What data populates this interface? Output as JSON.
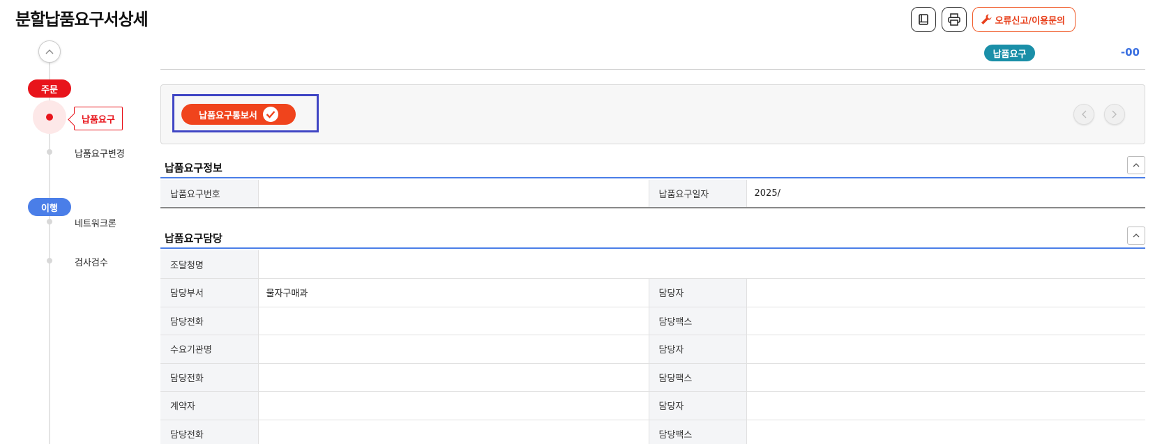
{
  "page": {
    "title": "분할납품요구서상세"
  },
  "top_actions": {
    "manual_label": "manual",
    "print_label": "print",
    "report_label": "오류신고/이용문의"
  },
  "timeline": {
    "order_stage": "주문",
    "exec_stage": "이행",
    "items": [
      {
        "label": "납품요구",
        "active": true
      },
      {
        "label": "납품요구변경"
      },
      {
        "label": "네트워크론"
      },
      {
        "label": "검사검수"
      }
    ]
  },
  "status": {
    "pill": "납품요구",
    "number": "-00"
  },
  "document": {
    "button_label": "납품요구통보서"
  },
  "section_info": {
    "title": "납품요구정보",
    "rows": [
      {
        "l1": "납품요구번호",
        "v1": "",
        "l2": "납품요구일자",
        "v2": "2025/"
      }
    ]
  },
  "section_contact": {
    "title": "납품요구담당",
    "rows": [
      {
        "l1": "조달청명",
        "v1": ""
      },
      {
        "l1": "담당부서",
        "v1": "물자구매과",
        "l2": "담당자",
        "v2": ""
      },
      {
        "l1": "담당전화",
        "v1": "",
        "l2": "담당팩스",
        "v2": ""
      },
      {
        "l1": "수요기관명",
        "v1": "",
        "l2": "담당자",
        "v2": ""
      },
      {
        "l1": "담당전화",
        "v1": "",
        "l2": "담당팩스",
        "v2": ""
      },
      {
        "l1": "계약자",
        "v1": "",
        "l2": "담당자",
        "v2": ""
      },
      {
        "l1": "담당전화",
        "v1": "",
        "l2": "담당팩스",
        "v2": ""
      }
    ]
  },
  "colors": {
    "accent_red": "#e8141b",
    "accent_blue": "#4a7ee8",
    "orange": "#f0441c",
    "teal": "#1a8fa8"
  }
}
